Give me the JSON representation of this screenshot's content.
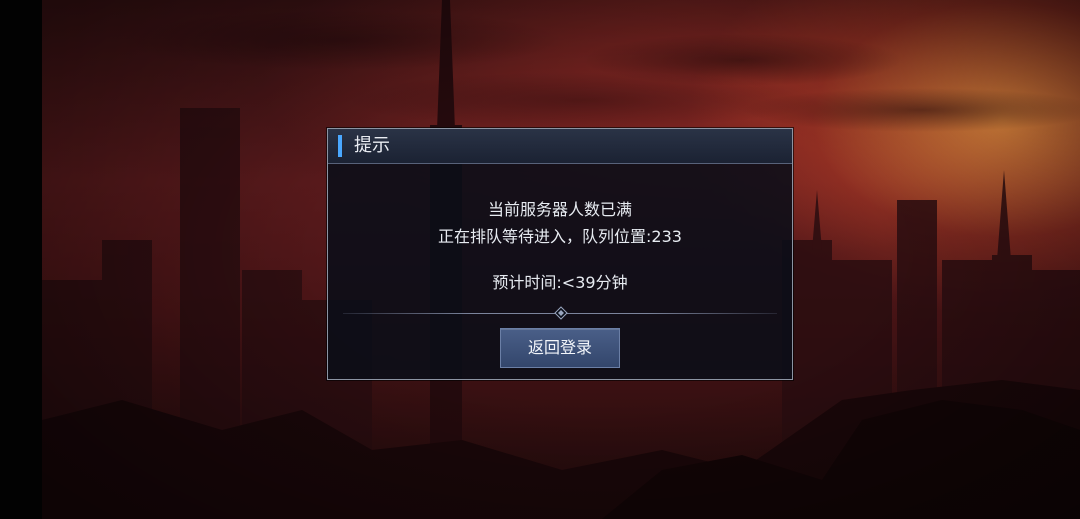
{
  "dialog": {
    "title": "提示",
    "line1": "当前服务器人数已满",
    "line2": "正在排队等待进入，队列位置:233",
    "line3": "预计时间:<39分钟",
    "button_label": "返回登录"
  },
  "colors": {
    "accent": "#4aa8ff",
    "button": "#3d5279",
    "dialog_bg": "#0a0e18"
  },
  "icons": [
    "divider-ornament-icon"
  ]
}
